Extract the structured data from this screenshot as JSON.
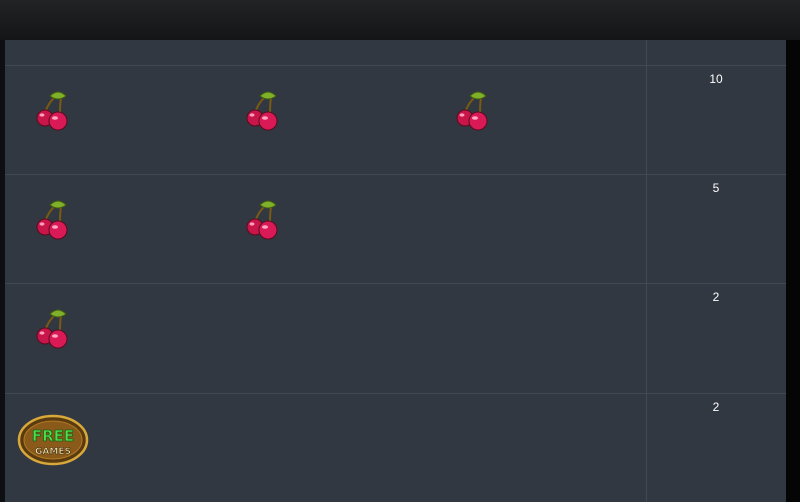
{
  "paytable": {
    "rows": [
      {
        "symbol": "cherry",
        "count": 3,
        "payout": "10"
      },
      {
        "symbol": "cherry",
        "count": 2,
        "payout": "5"
      },
      {
        "symbol": "cherry",
        "count": 1,
        "payout": "2"
      },
      {
        "symbol": "free-games",
        "count": 1,
        "payout": "2"
      }
    ],
    "free_games_logo_text": [
      "FREE",
      "GAMES"
    ]
  },
  "colors": {
    "background": "#323842",
    "grid": "#414955",
    "topbar": "#1b1c1e"
  },
  "icons": [
    "cherry-icon",
    "free-games-icon"
  ]
}
